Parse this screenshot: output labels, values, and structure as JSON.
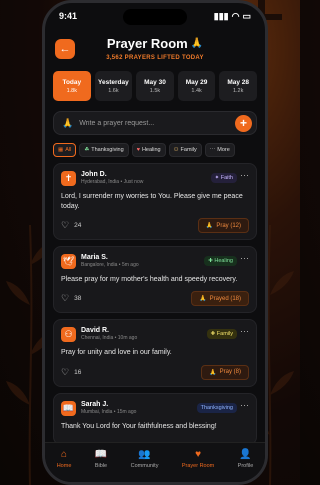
{
  "status": {
    "time": "9:41"
  },
  "header": {
    "title": "Prayer Room",
    "subtitle": "3,562 PRAYERS LIFTED TODAY"
  },
  "days": [
    {
      "label": "Today",
      "count": "1.8k",
      "active": true
    },
    {
      "label": "Yesterday",
      "count": "1.6k"
    },
    {
      "label": "May 30",
      "count": "1.5k"
    },
    {
      "label": "May 29",
      "count": "1.4k"
    },
    {
      "label": "May 28",
      "count": "1.2k"
    }
  ],
  "composer": {
    "placeholder": "Write a prayer request..."
  },
  "filters": [
    {
      "label": "All",
      "icon": "▦",
      "active": true
    },
    {
      "label": "Thanksgiving",
      "icon": "☘"
    },
    {
      "label": "Healing",
      "icon": "♥"
    },
    {
      "label": "Family",
      "icon": "⚇"
    },
    {
      "label": "More",
      "icon": "⋯"
    }
  ],
  "posts": [
    {
      "name": "John D.",
      "location": "Hyderabad, India",
      "time": "Just now",
      "tag": "Faith",
      "tag_icon": "✦",
      "tag_class": "",
      "avatar": "✝",
      "text": "Lord, I surrender my worries to You. Please give me peace today.",
      "likes": "24",
      "action": "Pray (12)"
    },
    {
      "name": "Maria S.",
      "location": "Bangalore, India",
      "time": "5m ago",
      "tag": "Healing",
      "tag_icon": "✚",
      "tag_class": "healing",
      "avatar": "🕊",
      "text": "Please pray for my mother's health and speedy recovery.",
      "likes": "38",
      "action": "Prayed (18)"
    },
    {
      "name": "David R.",
      "location": "Chennai, India",
      "time": "10m ago",
      "tag": "Family",
      "tag_icon": "✚",
      "tag_class": "family",
      "avatar": "⚇",
      "text": "Pray for unity and love in our family.",
      "likes": "16",
      "action": "Pray (8)"
    },
    {
      "name": "Sarah J.",
      "location": "Mumbai, India",
      "time": "15m ago",
      "tag": "Thanksgiving",
      "tag_icon": "",
      "tag_class": "thanks",
      "avatar": "📖",
      "text": "Thank You Lord for Your faithfulness and blessing!",
      "likes": "",
      "action": ""
    }
  ],
  "tabs": [
    {
      "label": "Home",
      "icon": "⌂",
      "active": true
    },
    {
      "label": "Bible",
      "icon": "📖"
    },
    {
      "label": "Community",
      "icon": "👥"
    },
    {
      "label": "Prayer Room",
      "icon": "♥"
    },
    {
      "label": "Profile",
      "icon": "👤"
    }
  ],
  "colors": {
    "accent": "#f06a1e",
    "background": "#0d0d0f",
    "card": "#18181b"
  }
}
